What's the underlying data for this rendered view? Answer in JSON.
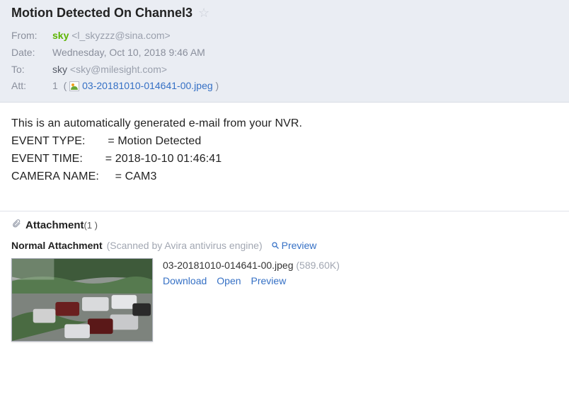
{
  "email": {
    "subject": "Motion Detected On Channel3",
    "from": {
      "label": "From:",
      "name": "sky",
      "address": "<l_skyzzz@sina.com>"
    },
    "date": {
      "label": "Date:",
      "value": "Wednesday, Oct 10, 2018 9:46 AM"
    },
    "to": {
      "label": "To:",
      "name": "sky",
      "address": "<sky@milesight.com>"
    },
    "att": {
      "label": "Att:",
      "count": "1",
      "open": "(",
      "close": ")",
      "filename": "03-20181010-014641-00.jpeg"
    }
  },
  "body": {
    "intro": "This is an automatically generated e-mail from your NVR.",
    "line1": "EVENT TYPE:       = Motion Detected",
    "line2": "EVENT TIME:       = 2018-10-10 01:46:41",
    "line3": "CAMERA NAME:     = CAM3"
  },
  "attachment": {
    "header": "Attachment",
    "count_text": "(1 )",
    "normal_label": "Normal Attachment",
    "scanned_label": "(Scanned by Avira antivirus engine)",
    "preview_link": "Preview",
    "item": {
      "filename": "03-20181010-014641-00.jpeg",
      "size": "(589.60K)",
      "actions": {
        "download": "Download",
        "open": "Open",
        "preview": "Preview"
      }
    }
  }
}
